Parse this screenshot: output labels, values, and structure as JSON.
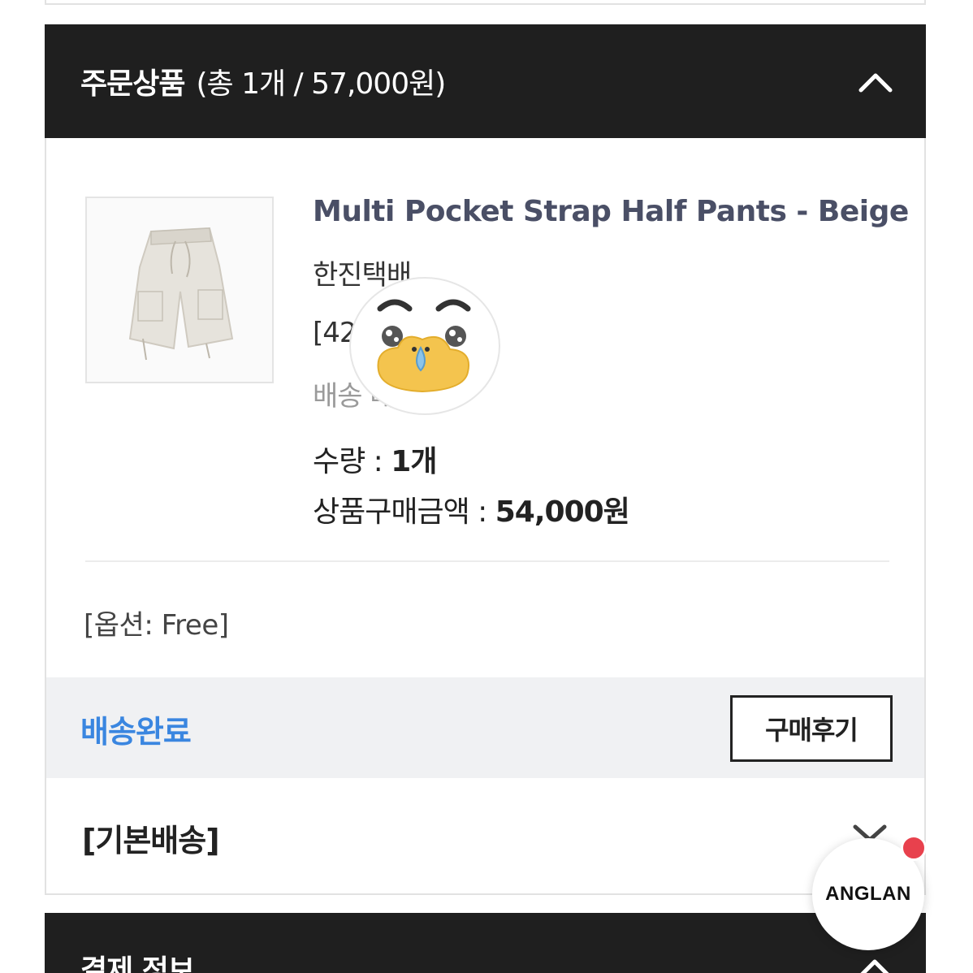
{
  "order_header": {
    "title": "주문상품",
    "summary": "(총 1개 / 57,000원)"
  },
  "product": {
    "name": "Multi Pocket Strap Half Pants - Beige",
    "brand_line": "한진택배",
    "bracket_line": "[42               40]",
    "delivery_line": "배송              배송",
    "qty_label": "수량 : ",
    "qty_value": "1개",
    "amount_label": "상품구매금액 : ",
    "amount_value": "54,000원",
    "option": "[옵션: Free]"
  },
  "status": {
    "label": "배송완료",
    "review_button": "구매후기"
  },
  "shipping": {
    "title": "[기본배송]"
  },
  "payment": {
    "title": "결제 정보"
  },
  "badge": {
    "label": "ANGLAN"
  },
  "icons": {
    "header_toggle": "chevron-up-icon",
    "shipping_toggle": "chevron-down-icon",
    "payment_toggle": "chevron-up-icon",
    "sticker": "crying-face-sticker-icon"
  },
  "colors": {
    "header_bg": "#1f1f1f",
    "status_blue": "#3a86e0",
    "product_name": "#4a4f66",
    "notification_dot": "#e8414d"
  }
}
